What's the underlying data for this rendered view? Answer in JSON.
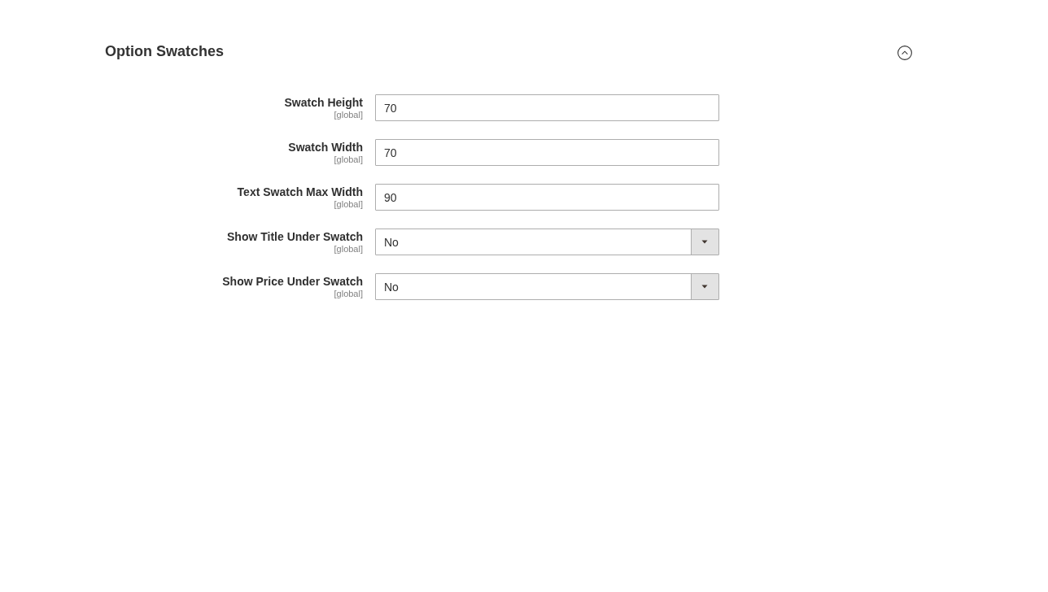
{
  "section": {
    "title": "Option Swatches",
    "expanded": true
  },
  "fields": [
    {
      "kind": "text",
      "label": "Swatch Height",
      "scope": "[global]",
      "value": "70"
    },
    {
      "kind": "text",
      "label": "Swatch Width",
      "scope": "[global]",
      "value": "70"
    },
    {
      "kind": "text",
      "label": "Text Swatch Max Width",
      "scope": "[global]",
      "value": "90"
    },
    {
      "kind": "select",
      "label": "Show Title Under Swatch",
      "scope": "[global]",
      "value": "No"
    },
    {
      "kind": "select",
      "label": "Show Price Under Swatch",
      "scope": "[global]",
      "value": "No"
    }
  ]
}
